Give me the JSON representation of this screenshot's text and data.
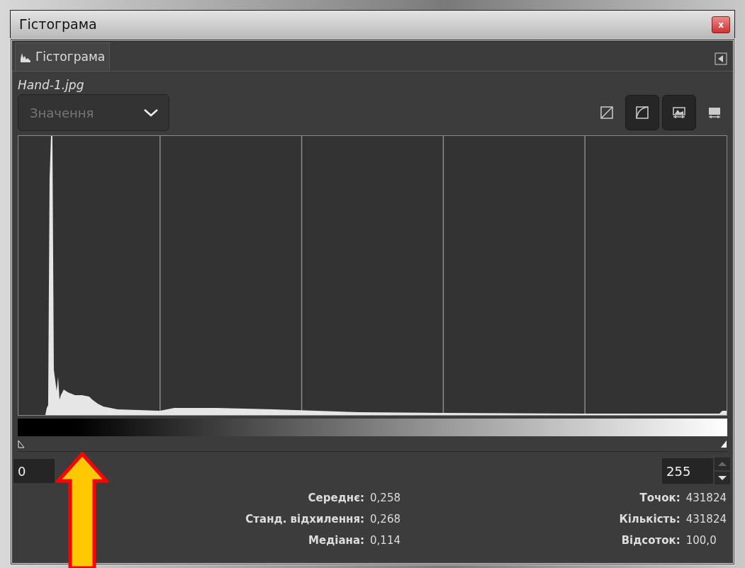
{
  "window": {
    "title": "Гістограма",
    "close": "x"
  },
  "tab": {
    "label": "Гістограма",
    "selected": true
  },
  "image_name": "Hand-1.jpg",
  "channel": {
    "placeholder": "Значення"
  },
  "view_buttons": [
    {
      "kind": "linear",
      "selected": false
    },
    {
      "kind": "log",
      "selected": true
    },
    {
      "kind": "range",
      "selected": true
    },
    {
      "kind": "full",
      "selected": false
    }
  ],
  "range": {
    "low": "0",
    "high": "255"
  },
  "stats_left": [
    {
      "label": "Середнє:",
      "value": "0,258"
    },
    {
      "label": "Станд. відхилення:",
      "value": "0,268"
    },
    {
      "label": "Медіана:",
      "value": "0,114"
    }
  ],
  "stats_right": [
    {
      "label": "Точок:",
      "value": "431824"
    },
    {
      "label": "Кількість:",
      "value": "431824"
    },
    {
      "label": "Відсоток:",
      "value": "100,0"
    }
  ]
}
